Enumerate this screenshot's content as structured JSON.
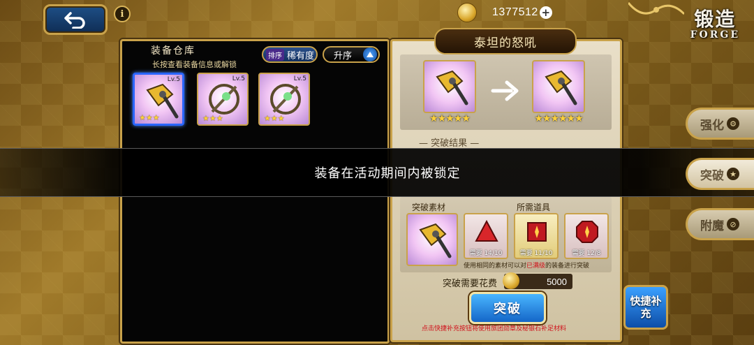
{
  "topbar": {
    "coins": "1377512",
    "plus_label": "+",
    "info_label": "i"
  },
  "forge_title": {
    "cn": "锻造",
    "en": "FORGE"
  },
  "warehouse": {
    "title": "装备仓库",
    "subtitle": "长按查看装备信息或解锁",
    "sort_tag": "排序",
    "sort_value": "稀有度",
    "order_label": "升序",
    "items": [
      {
        "level": "Lv.5",
        "stars": "★★★",
        "selected": true
      },
      {
        "level": "Lv.5",
        "stars": "★★★",
        "selected": false
      },
      {
        "level": "Lv.5",
        "stars": "★★★",
        "selected": false
      }
    ]
  },
  "forge_panel": {
    "item_name": "泰坦的怒吼",
    "before_stars": "★★★★★",
    "after_stars": "★★★★★★",
    "result_label": "— 突破结果 —",
    "material_label": "突破素材",
    "needed_label": "所需道具",
    "requirements": [
      {
        "count": "需要 14/10",
        "color": "#c92a2a"
      },
      {
        "count": "需要 11/10",
        "color": "#d8b83a"
      },
      {
        "count": "需要 12/8",
        "color": "#c92a2a"
      }
    ],
    "hint_prefix": "使用相同的素材可以对",
    "hint_highlight": "已满级",
    "hint_suffix": "的装备进行突破",
    "cost_label": "突破需要花费",
    "cost_value": "5000",
    "breakthrough_button": "突破",
    "bottom_hint": "点击快捷补充按钮将使用旅团勋章及秘银石补足材料"
  },
  "lock_message": "装备在活动期间内被锁定",
  "quick_refill": "快捷补充",
  "side_tabs": [
    {
      "label": "强化",
      "icon": "⚙"
    },
    {
      "label": "突破",
      "icon": "★"
    },
    {
      "label": "附魔",
      "icon": "⊘"
    }
  ],
  "colors": {
    "gold_border": "#c9a24a",
    "button_blue": "#1466c8",
    "warning_red": "#d0101a"
  }
}
